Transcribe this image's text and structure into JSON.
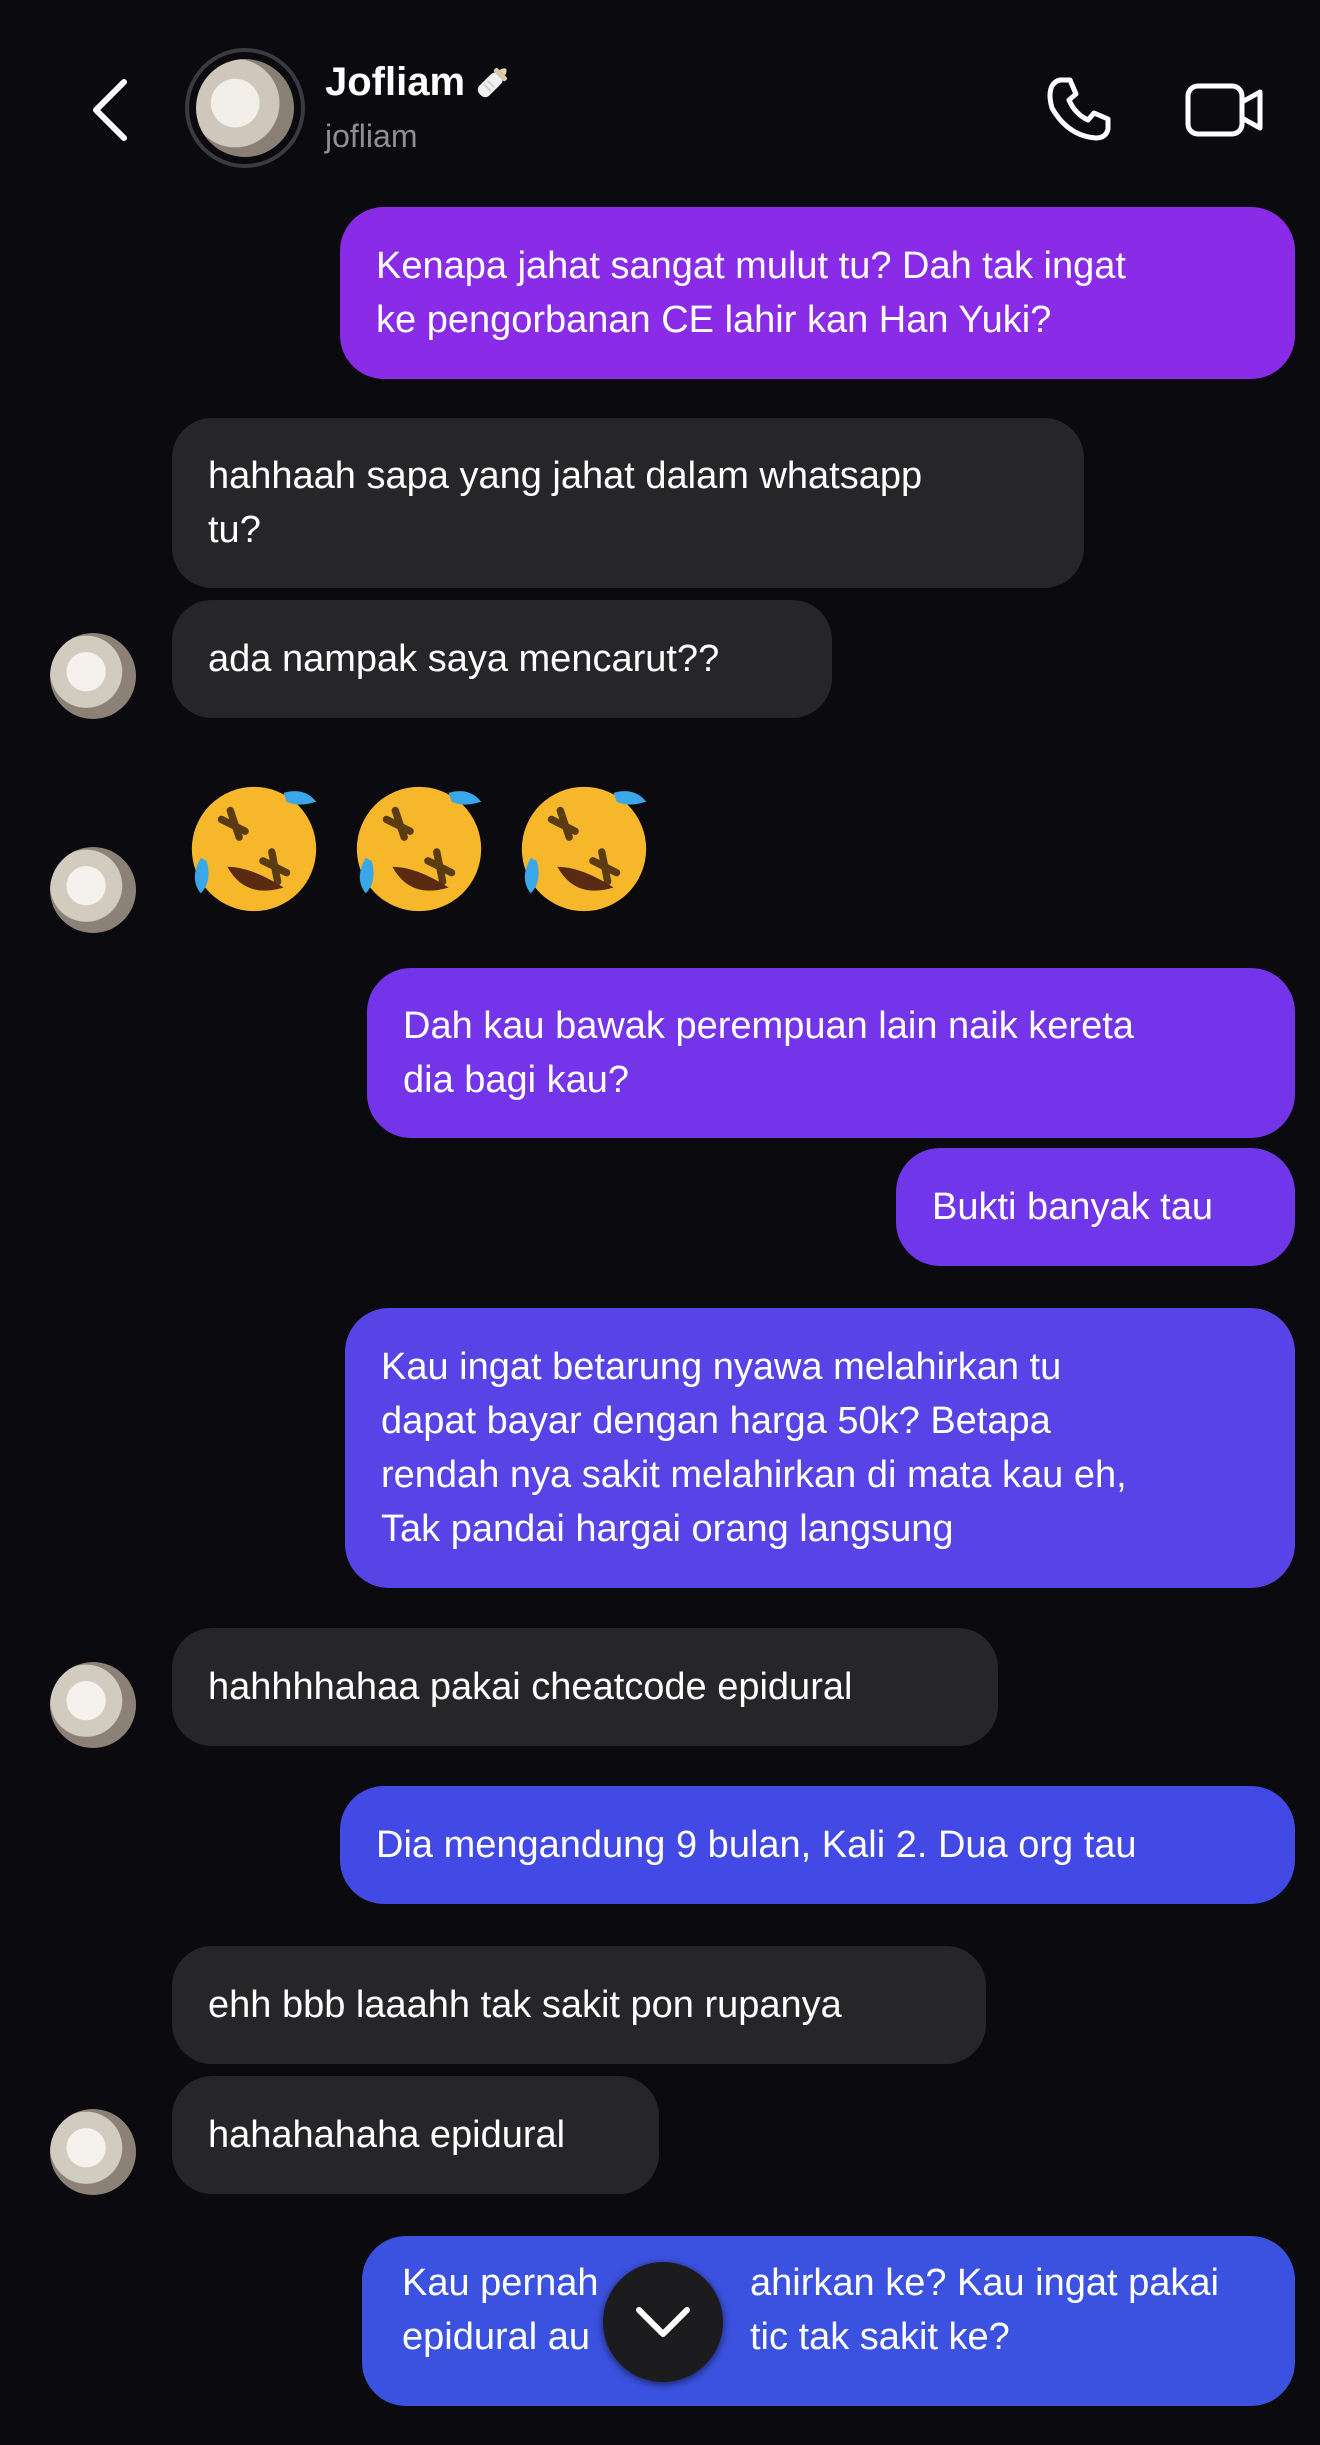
{
  "header": {
    "name": "Jofliam",
    "username": "jofliam",
    "name_emoji_icon": "baby-bottle-icon",
    "back_icon": "chevron-left-icon",
    "call_icon": "phone-icon",
    "video_icon": "video-camera-icon"
  },
  "messages": [
    {
      "side": "out",
      "text": "Kenapa jahat sangat mulut tu? Dah tak ingat\nke pengorbanan CE lahir kan Han Yuki?"
    },
    {
      "side": "in",
      "text": "hahhaah sapa yang jahat dalam whatsapp\ntu?"
    },
    {
      "side": "in",
      "text": "ada nampak saya mencarut??"
    },
    {
      "side": "in",
      "text": "🤣🤣🤣",
      "emoji": "rolling-on-floor-laughing-icon",
      "count": 3
    },
    {
      "side": "out",
      "text": "Dah kau bawak perempuan lain naik kereta\ndia bagi kau?"
    },
    {
      "side": "out",
      "text": "Bukti banyak tau"
    },
    {
      "side": "out",
      "text": "Kau ingat betarung nyawa melahirkan tu\ndapat bayar dengan harga 50k? Betapa\nrendah nya sakit melahirkan di mata kau eh,\nTak pandai hargai orang langsung"
    },
    {
      "side": "in",
      "text": "hahhhhahaa pakai cheatcode epidural"
    },
    {
      "side": "out",
      "text": "Dia mengandung 9 bulan, Kali 2. Dua org tau"
    },
    {
      "side": "in",
      "text": "ehh bbb laaahh tak sakit pon rupanya"
    },
    {
      "side": "in",
      "text": "hahahahaha epidural"
    },
    {
      "side": "out",
      "text_line1_left": "Kau pernah",
      "text_line1_right": "ahirkan ke? Kau ingat pakai",
      "text_line2_left": "epidural au",
      "text_line2_right": "tic tak sakit ke?"
    }
  ],
  "scroll_down_icon": "chevron-down-icon",
  "colors": {
    "background": "#0b0a0e",
    "incoming_bubble": "#262629",
    "outgoing_top": "#8a2be8",
    "outgoing_bottom": "#3b52e0",
    "secondary_text": "#8e8e93"
  }
}
